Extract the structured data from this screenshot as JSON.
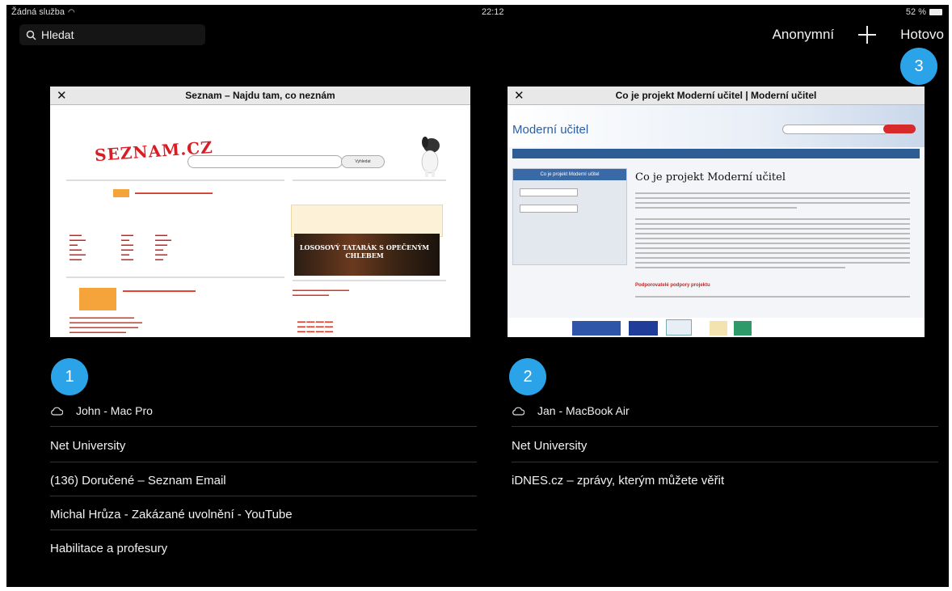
{
  "status": {
    "carrier": "Žádná služba",
    "time": "22:12",
    "battery": "52 %"
  },
  "search": {
    "placeholder": "Hledat"
  },
  "top_actions": {
    "private_label": "Anonymní",
    "done_label": "Hotovo"
  },
  "badges": [
    "1",
    "2",
    "3"
  ],
  "tabs": [
    {
      "title": "Seznam – Najdu tam, co neznám",
      "logo": "SEZNAM.CZ",
      "button": "Vyhledat",
      "promo": "LOSOSOVÝ TATARÁK S OPEČENÝM CHLEBEM"
    },
    {
      "title": "Co je projekt Moderní učitel | Moderní učitel",
      "logo": "Moderní učitel",
      "heading": "Co je projekt Moderní učitel",
      "sidebar_head": "Co je projekt Moderní učitel",
      "subheading": "Podporovatelé podpory projektu"
    }
  ],
  "devices": [
    {
      "name": "John - Mac Pro",
      "items": [
        "Net University",
        "(136) Doručené – Seznam Email",
        "Michal Hrůza - Zakázané uvolnění - YouTube",
        "Habilitace a profesury"
      ]
    },
    {
      "name": "Jan - MacBook Air",
      "items": [
        "Net University",
        "iDNES.cz – zprávy, kterým můžete věřit"
      ]
    }
  ]
}
